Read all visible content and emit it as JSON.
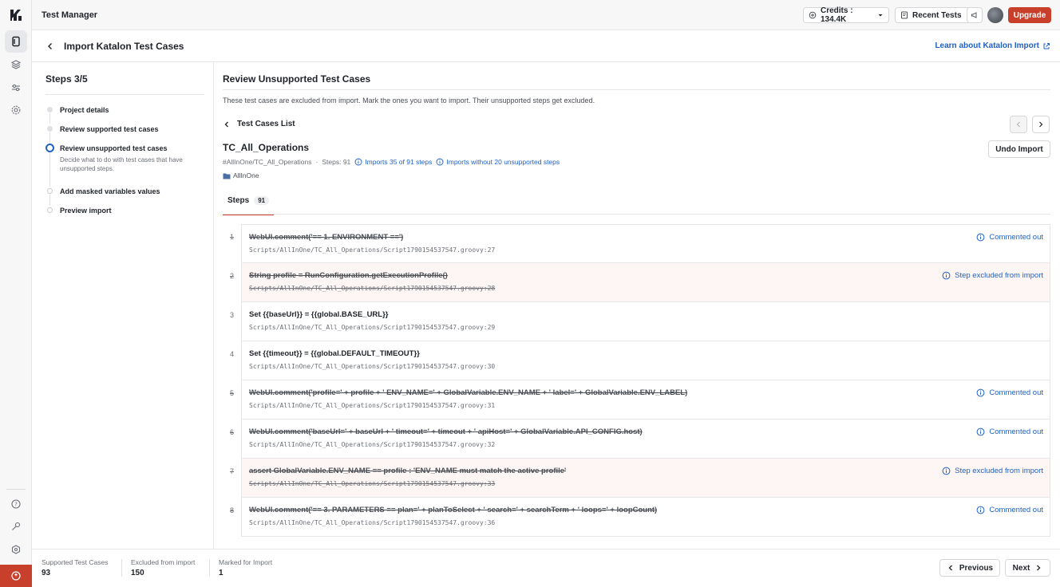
{
  "app": {
    "title": "Test Manager"
  },
  "topbar": {
    "credits_label": "Credits : 134.4K",
    "recent_tests_label": "Recent Tests",
    "upgrade_label": "Upgrade"
  },
  "header": {
    "title": "Import Katalon Test Cases",
    "learn_link": "Learn about Katalon Import"
  },
  "steps_panel": {
    "title": "Steps 3/5",
    "steps": [
      {
        "label": "Project details",
        "state": "done"
      },
      {
        "label": "Review supported test cases",
        "state": "done"
      },
      {
        "label": "Review unsupported test cases",
        "state": "active",
        "description": "Decide what to do with test cases that have unsupported steps."
      },
      {
        "label": "Add masked variables values",
        "state": "pending"
      },
      {
        "label": "Preview import",
        "state": "pending"
      }
    ]
  },
  "main": {
    "title": "Review Unsupported Test Cases",
    "description": "These test cases are excluded from import. Mark the ones you want to import. Their unsupported steps get excluded.",
    "list_back_label": "Test Cases List",
    "test_case": {
      "name": "TC_All_Operations",
      "path": "#AllInOne/TC_All_Operations",
      "separator": "·",
      "steps_count": "Steps: 91",
      "imports_info": "Imports 35 of 91 steps",
      "imports_without": "Imports without 20 unsupported steps",
      "folder": "AllInOne"
    },
    "undo_label": "Undo Import",
    "tab": {
      "label": "Steps",
      "count": "91"
    },
    "rows": [
      {
        "num": "1",
        "code": "WebUI.comment('== 1. ENVIRONMENT ==')",
        "path": "Scripts/AllInOne/TC_All_Operations/Script1790154537547.groovy:27",
        "status": "Commented out",
        "excluded": false,
        "strike_code": true,
        "strike_path": false
      },
      {
        "num": "2",
        "code": "String profile = RunConfiguration.getExecutionProfile()",
        "path": "Scripts/AllInOne/TC_All_Operations/Script1790154537547.groovy:28",
        "status": "Step excluded from import",
        "excluded": true,
        "strike_code": true,
        "strike_path": true
      },
      {
        "num": "3",
        "code": "Set {{baseUrl}} = {{global.BASE_URL}}",
        "path": "Scripts/AllInOne/TC_All_Operations/Script1790154537547.groovy:29",
        "status": "",
        "excluded": false,
        "strike_code": false,
        "strike_path": false
      },
      {
        "num": "4",
        "code": "Set {{timeout}} = {{global.DEFAULT_TIMEOUT}}",
        "path": "Scripts/AllInOne/TC_All_Operations/Script1790154537547.groovy:30",
        "status": "",
        "excluded": false,
        "strike_code": false,
        "strike_path": false
      },
      {
        "num": "5",
        "code": "WebUI.comment('profile=' + profile + ' ENV_NAME=' + GlobalVariable.ENV_NAME + ' label=' + GlobalVariable.ENV_LABEL)",
        "path": "Scripts/AllInOne/TC_All_Operations/Script1790154537547.groovy:31",
        "status": "Commented out",
        "excluded": false,
        "strike_code": true,
        "strike_path": false
      },
      {
        "num": "6",
        "code": "WebUI.comment('baseUrl=' + baseUrl + ' timeout=' + timeout + ' apiHost=' + GlobalVariable.API_CONFIG.host)",
        "path": "Scripts/AllInOne/TC_All_Operations/Script1790154537547.groovy:32",
        "status": "Commented out",
        "excluded": false,
        "strike_code": true,
        "strike_path": false
      },
      {
        "num": "7",
        "code": "assert GlobalVariable.ENV_NAME == profile : 'ENV_NAME must match the active profile'",
        "path": "Scripts/AllInOne/TC_All_Operations/Script1790154537547.groovy:33",
        "status": "Step excluded from import",
        "excluded": true,
        "strike_code": true,
        "strike_path": true
      },
      {
        "num": "8",
        "code": "WebUI.comment('== 3. PARAMETERS == plan=' + planToSelect + ' search=' + searchTerm + ' loops=' + loopCount)",
        "path": "Scripts/AllInOne/TC_All_Operations/Script1790154537547.groovy:36",
        "status": "Commented out",
        "excluded": false,
        "strike_code": true,
        "strike_path": false
      }
    ]
  },
  "footer": {
    "supported_label": "Supported Test Cases",
    "supported_value": "93",
    "excluded_label": "Excluded from import",
    "excluded_value": "150",
    "marked_label": "Marked for Import",
    "marked_value": "1",
    "previous_label": "Previous",
    "next_label": "Next"
  },
  "colors": {
    "accent": "#c8402b",
    "link": "#1f61c5",
    "excluded_row_bg": "#fdf6f5"
  }
}
